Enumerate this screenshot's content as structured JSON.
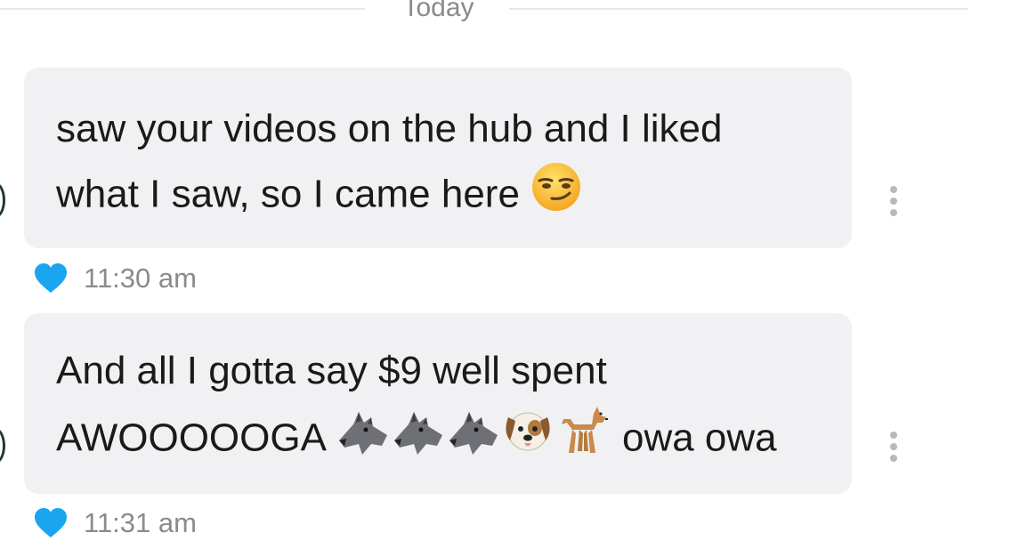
{
  "divider": {
    "label": "Today"
  },
  "messages": [
    {
      "lines": [
        "saw your videos on the hub and I liked",
        "what I saw, so I came here"
      ],
      "emojis": [
        "smirking-face"
      ],
      "time": "11:30 am",
      "reaction": "heart"
    },
    {
      "lines": [
        "And all I gotta say $9 well spent",
        "AWOOOOOGA",
        "owa owa"
      ],
      "emojis": [
        "wolf",
        "wolf",
        "wolf",
        "dog-face",
        "dog"
      ],
      "time": "11:31 am",
      "reaction": "heart"
    }
  ],
  "colors": {
    "bubble": "#f1f1f3",
    "heart": "#1aa5f0",
    "meta_text": "#8a8a8f",
    "divider": "#e7e7ea"
  }
}
